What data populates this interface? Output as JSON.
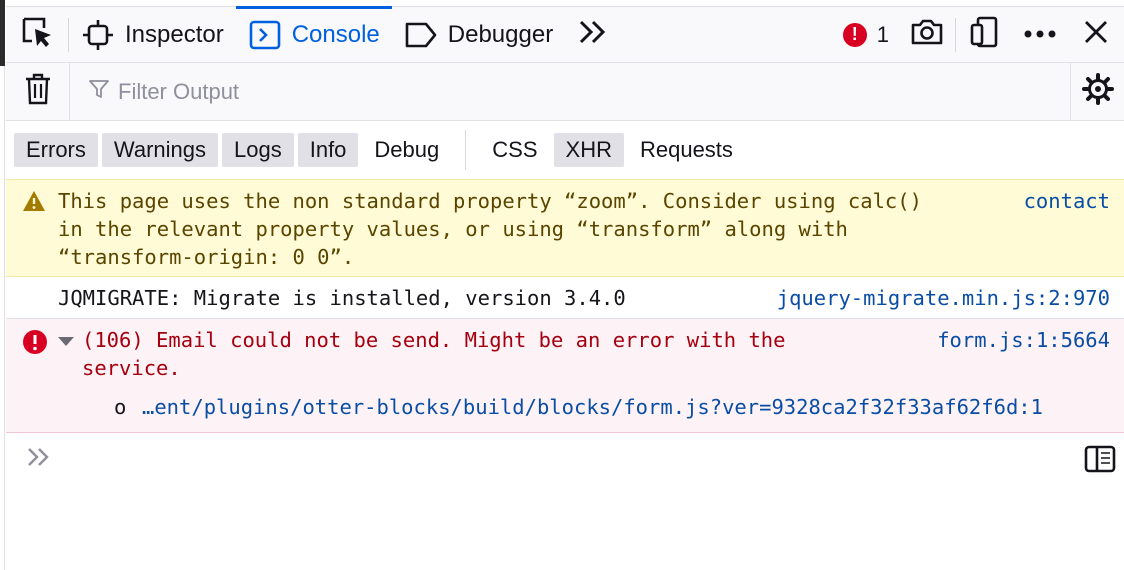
{
  "toolbar": {
    "tabs": [
      {
        "label": "Inspector",
        "icon": "inspector-icon"
      },
      {
        "label": "Console",
        "icon": "console-icon"
      },
      {
        "label": "Debugger",
        "icon": "debugger-icon"
      }
    ],
    "error_count": "1",
    "accent_color": "#0060df"
  },
  "filter": {
    "placeholder": "Filter Output"
  },
  "levels": {
    "errors": "Errors",
    "warnings": "Warnings",
    "logs": "Logs",
    "info": "Info",
    "debug": "Debug",
    "css": "CSS",
    "xhr": "XHR",
    "requests": "Requests"
  },
  "messages": {
    "warning": {
      "text": "This page uses the non standard property “zoom”. Consider using calc()\nin the relevant property values, or using “transform” along with\n“transform-origin: 0 0”.",
      "location": "contact"
    },
    "log": {
      "text": "JQMIGRATE: Migrate is installed, version 3.4.0",
      "location": "jquery-migrate.min.js:2:970"
    },
    "error": {
      "text": "(106) Email could not be send. Might be an error with the\nservice.",
      "location": "form.js:1:5664",
      "frame_function": "o",
      "frame_location": "…ent/plugins/otter-blocks/build/blocks/form.js?ver=9328ca2f32f33af62f6d:1"
    }
  }
}
